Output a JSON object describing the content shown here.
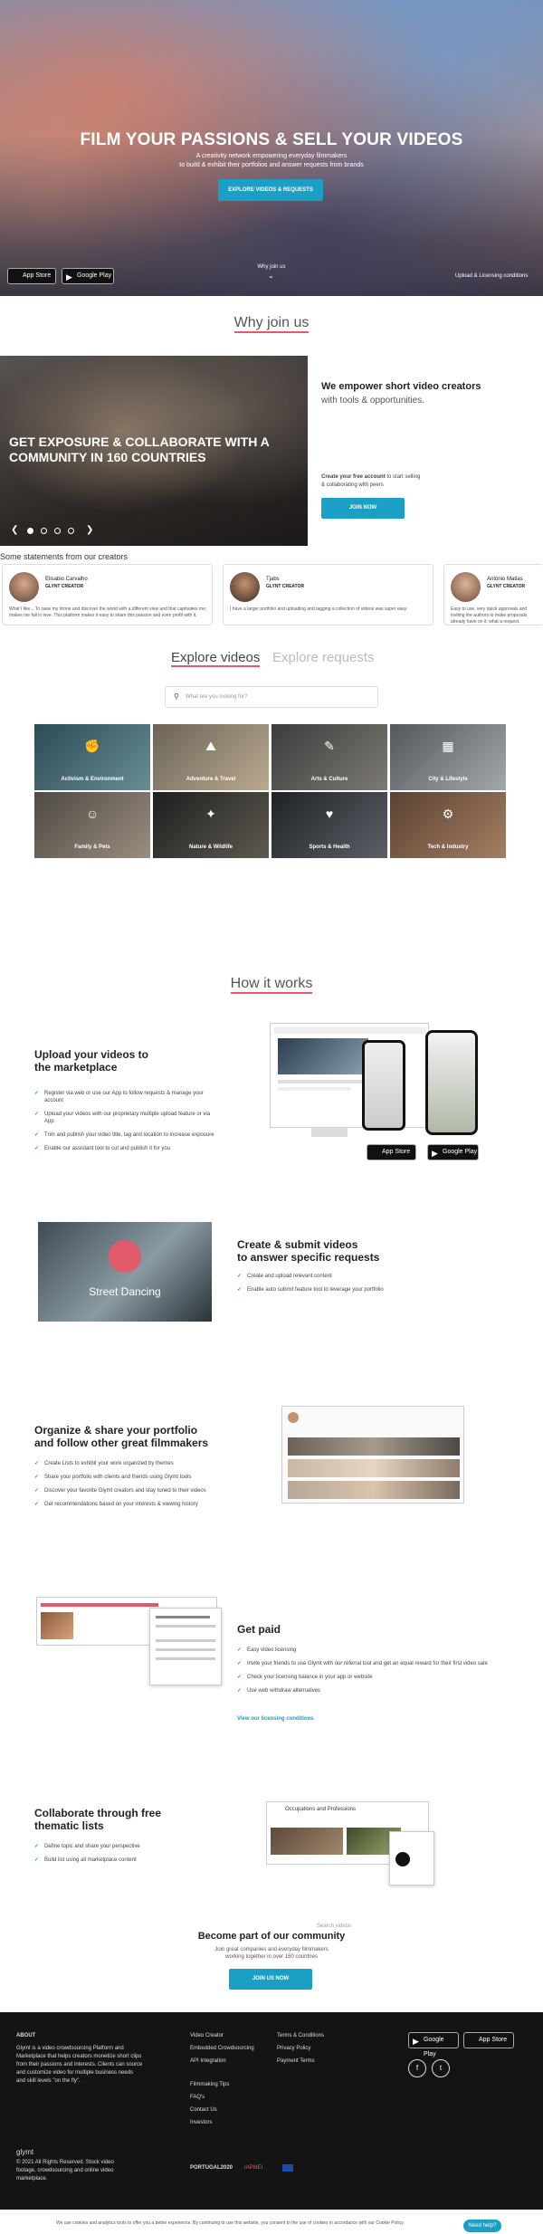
{
  "hero": {
    "title": "FILM YOUR PASSIONS & SELL YOUR VIDEOS",
    "sub_line1": "A creativity network empowering everyday filmmakers",
    "sub_line2": "to build & exhibit their portfolios and answer requests from brands",
    "cta": "EXPLORE VIDEOS & REQUESTS",
    "app_store": "App Store",
    "google_play": "Google Play",
    "why_join": "Why join us",
    "upload_link": "Upload & Licensing conditions"
  },
  "why_join_title": "Why join us",
  "slider": {
    "caption": "GET EXPOSURE & COLLABORATE WITH A COMMUNITY IN 160 COUNTRIES",
    "heading": "We empower short video creators",
    "subheading": "with tools & opportunities.",
    "small_bold": "Create your free account",
    "small_rest": " to start selling",
    "small_line2": "& collaborating with peers",
    "join": "JOIN NOW",
    "prev": "❮",
    "next": "❯"
  },
  "statements": {
    "title": "Some statements from our creators",
    "cards": [
      {
        "name": "Elisabio Carvalho",
        "role": "GLYNT CREATOR",
        "quote": "What I like... To raise my drone and discover the world with a different view and that captivates me; makes me fall in love. This platform makes it easy to share this passion and even profit with it."
      },
      {
        "name": "Tjabs",
        "role": "GLYNT CREATOR",
        "quote": "I have a larger portfolio and uploading and tagging a collection of videos was super easy."
      },
      {
        "name": "António Matias",
        "role": "GLYNT CREATOR",
        "quote": "Easy to use, very quick approvals and inviting the authors to make proposals already have on it; what a request."
      }
    ]
  },
  "explore": {
    "tab_videos": "Explore videos",
    "tab_requests": "Explore requests",
    "search_placeholder": "What are you looking for?",
    "categories": [
      "Activism & Environment",
      "Adventure & Travel",
      "Arts & Culture",
      "City & Lifestyle",
      "Family & Pets",
      "Nature & Wildlife",
      "Sports & Health",
      "Tech & Industry"
    ]
  },
  "how": {
    "title": "How it works",
    "s1": {
      "title1": "Upload your videos to",
      "title2": "the marketplace",
      "items": [
        "Register via web or use our App to follow requests & manage your account",
        "Upload your videos with our proprietary multiple upload feature or via App",
        "Trim and publish your video title, tag and location to increase exposure",
        "Enable our assistant tool to cut and publish it for you"
      ]
    },
    "s2": {
      "title1": "Create & submit videos",
      "title2": "to answer specific requests",
      "video_label": "Street Dancing",
      "items": [
        "Create and upload relevant content",
        "Enable auto submit feature tool to leverage your portfolio"
      ]
    },
    "s3": {
      "title1": "Organize & share your portfolio",
      "title2": "and follow other great filmmakers",
      "items": [
        "Create Lists to exhibit your work organized by themes",
        "Share your portfolio with clients and friends using Glymt tools",
        "Discover your favorite Glymt creators and stay tuned to their videos",
        "Get recommendations based on your interests & viewing history"
      ]
    },
    "s4": {
      "title": "Get paid",
      "items": [
        "Easy video licensing",
        "Invite your friends to use Glymt with our referral tool and get an equal reward for their first video sale",
        "Check your licensing balance in your app or website",
        "Use web withdraw alternatives"
      ],
      "link": "View our licensing conditions"
    },
    "s5": {
      "title1": "Collaborate through free",
      "title2": "thematic lists",
      "items": [
        "Define topic and share your perspective",
        "Build list using all marketplace content"
      ],
      "list_title": "Occupations and Professions"
    }
  },
  "become": {
    "title": "Become part of our community",
    "line1": "Join great companies and everyday filmmakers",
    "line2": "working together in over 160 countries",
    "cta": "JOIN US NOW",
    "search_hint": "Search videos"
  },
  "footer": {
    "about_title": "ABOUT",
    "about_text": "Glymt is a video crowdsourcing Platform and Marketplace that helps creators monetize short clips from their passions and interests. Clients can source and customize video for multiple business needs and skill levels \"on the fly\".",
    "col1": [
      "Video Creator",
      "Embedded Crowdsourcing",
      "API Integration",
      "",
      "Filmmaking Tips",
      "FAQ's",
      "Contact Us",
      "Investors"
    ],
    "col2": [
      "Terms & Conditions",
      "Privacy Policy",
      "Payment Terms"
    ],
    "logo": "glymt",
    "copyright": "© 2021 All Rights Reserved. Stock video footage, crowdsourcing and online video marketplace.",
    "partner1": "PORTUGAL2020",
    "partner2": "IAPMEI"
  },
  "cookie": {
    "text": "We use cookies and analytics tools to offer you a better experience. By continuing to use this website, you consent to the use of cookies in accordance with our Cookie Policy.",
    "help": "Need help?"
  },
  "colors": {
    "accent": "#1aa0c4",
    "underline": "#e05a6a",
    "check": "#2da44e",
    "footer_bg": "#141414"
  }
}
